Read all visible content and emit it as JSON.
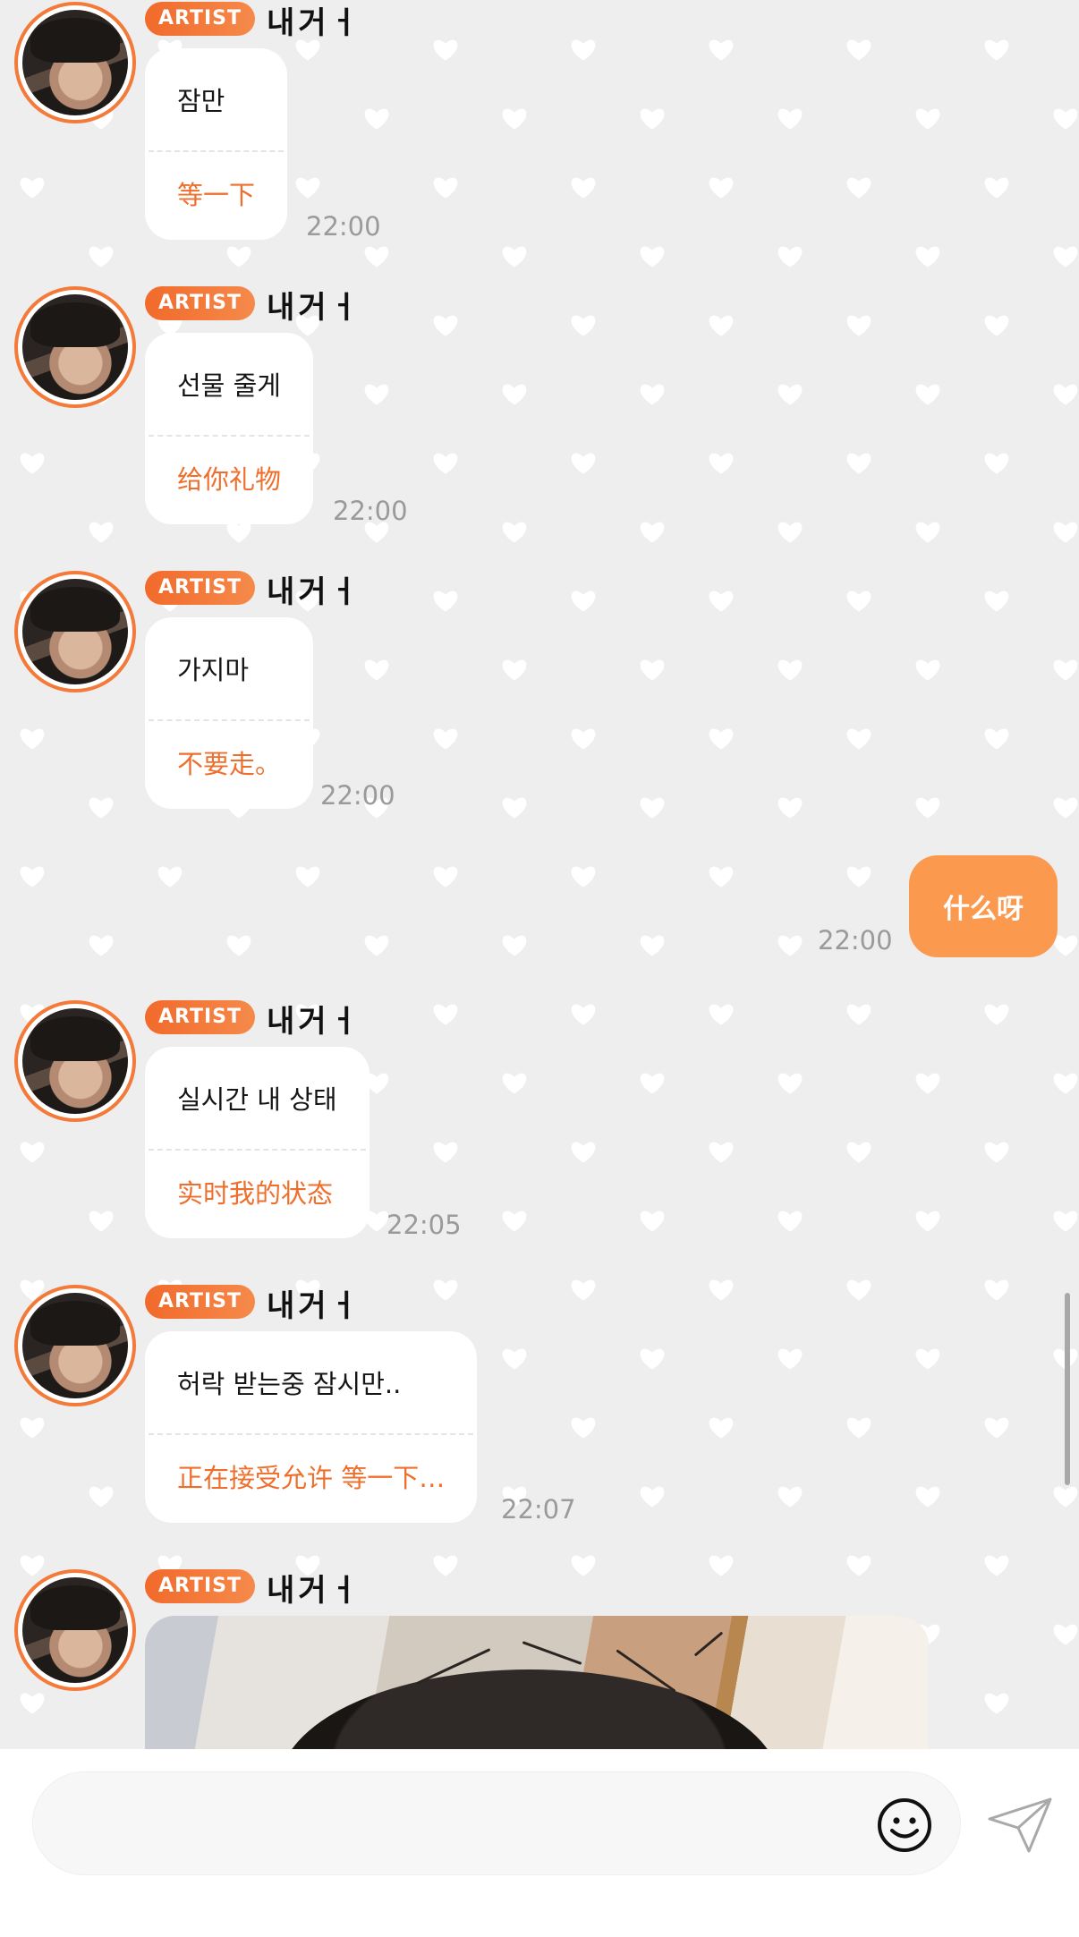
{
  "theme": {
    "accent": "#f47a3a",
    "badge_gradient": [
      "#f16a2b",
      "#f58a4b"
    ],
    "translation_text": "#ee6f2c",
    "my_bubble": "#fb9a4f",
    "background": "#eeeeee",
    "heart_pattern": "#ffffff"
  },
  "chat": {
    "messages": [
      {
        "from": "artist",
        "badge": "ARTIST",
        "sender": "내거ㅓ",
        "original": "잠만",
        "translation": "等一下",
        "time": "22:00"
      },
      {
        "from": "artist",
        "badge": "ARTIST",
        "sender": "내거ㅓ",
        "original": "선물 줄게",
        "translation": "给你礼物",
        "time": "22:00"
      },
      {
        "from": "artist",
        "badge": "ARTIST",
        "sender": "내거ㅓ",
        "original": "가지마",
        "translation": "不要走。",
        "time": "22:00"
      },
      {
        "from": "me",
        "text": "什么呀",
        "time": "22:00"
      },
      {
        "from": "artist",
        "badge": "ARTIST",
        "sender": "내거ㅓ",
        "original": "실시간 내 상태",
        "translation": "实时我的状态",
        "time": "22:05"
      },
      {
        "from": "artist",
        "badge": "ARTIST",
        "sender": "내거ㅓ",
        "original": "허락 받는중 잠시만..",
        "translation": "正在接受允许 等一下…",
        "time": "22:07"
      },
      {
        "from": "artist",
        "badge": "ARTIST",
        "sender": "내거ㅓ",
        "attachment": "photo"
      }
    ]
  },
  "composer": {
    "placeholder": "",
    "value": "",
    "emoji_icon": "smiley-icon",
    "send_icon": "paper-plane-icon"
  }
}
